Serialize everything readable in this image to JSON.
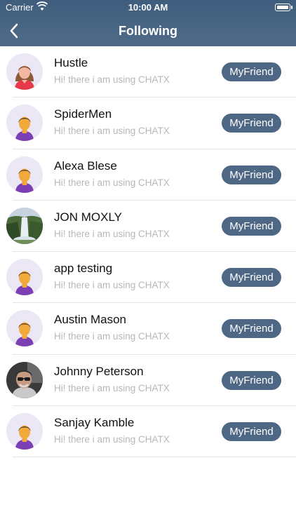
{
  "status_bar": {
    "carrier": "Carrier",
    "time": "10:00 AM"
  },
  "nav": {
    "title": "Following"
  },
  "friends": [
    {
      "name": "Hustle",
      "status": "Hi! there i am using CHATX",
      "button": "MyFriend",
      "avatar": "female-avatar"
    },
    {
      "name": "SpiderMen",
      "status": "Hi! there i am using CHATX",
      "button": "MyFriend",
      "avatar": "male-avatar"
    },
    {
      "name": "Alexa Blese",
      "status": "Hi! there i am using CHATX",
      "button": "MyFriend",
      "avatar": "male-avatar"
    },
    {
      "name": "JON MOXLY",
      "status": "Hi! there i am using CHATX",
      "button": "MyFriend",
      "avatar": "waterfall-photo"
    },
    {
      "name": "app testing",
      "status": "Hi! there i am using CHATX",
      "button": "MyFriend",
      "avatar": "male-avatar"
    },
    {
      "name": "Austin Mason",
      "status": "Hi! there i am using CHATX",
      "button": "MyFriend",
      "avatar": "male-avatar"
    },
    {
      "name": "Johnny Peterson",
      "status": "Hi! there i am using CHATX",
      "button": "MyFriend",
      "avatar": "person-photo"
    },
    {
      "name": "Sanjay Kamble",
      "status": "Hi! there i am using CHATX",
      "button": "MyFriend",
      "avatar": "male-avatar"
    }
  ],
  "colors": {
    "header": "#4a6481",
    "button": "#4e6785",
    "secondary_text": "#b7b7b7"
  }
}
